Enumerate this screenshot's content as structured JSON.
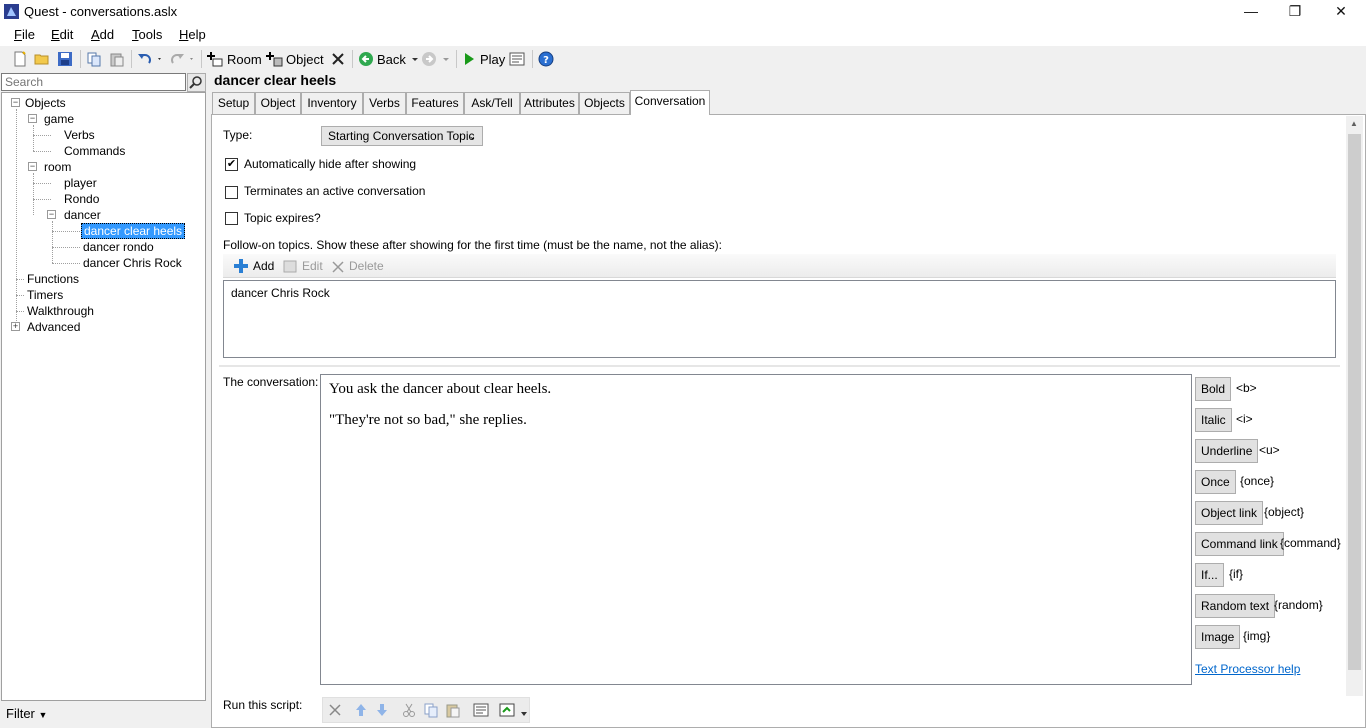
{
  "window": {
    "title": "Quest - conversations.aslx",
    "minimize": "—",
    "maximize": "❐",
    "close": "✕"
  },
  "menu": [
    "File",
    "Edit",
    "Add",
    "Tools",
    "Help"
  ],
  "toolbar": {
    "room_label": "Room",
    "object_label": "Object",
    "back_label": "Back",
    "play_label": "Play"
  },
  "left_panel": {
    "search_placeholder": "Search",
    "filter_label": "Filter",
    "tree": {
      "objects": "Objects",
      "game": "game",
      "verbs": "Verbs",
      "commands": "Commands",
      "room": "room",
      "player": "player",
      "rondo": "Rondo",
      "dancer": "dancer",
      "dancer_clear_heels": "dancer clear heels",
      "dancer_rondo": "dancer rondo",
      "dancer_chris_rock": "dancer Chris Rock",
      "functions": "Functions",
      "timers": "Timers",
      "walkthrough": "Walkthrough",
      "advanced": "Advanced"
    }
  },
  "editor": {
    "object_title": "dancer clear heels",
    "tabs": [
      "Setup",
      "Object",
      "Inventory",
      "Verbs",
      "Features",
      "Ask/Tell",
      "Attributes",
      "Objects",
      "Conversation"
    ],
    "active_tab": "Conversation",
    "type_label": "Type:",
    "type_value": "Starting Conversation Topic",
    "auto_hide_label": "Automatically hide after showing",
    "auto_hide_checked": true,
    "terminates_label": "Terminates an active conversation",
    "terminates_checked": false,
    "expires_label": "Topic expires?",
    "expires_checked": false,
    "followon_label": "Follow-on topics. Show these after showing for the first time (must be the name, not the alias):",
    "followon_add": "Add",
    "followon_edit": "Edit",
    "followon_delete": "Delete",
    "followon_items": [
      "dancer Chris Rock"
    ],
    "conversation_label": "The conversation:",
    "conversation_text": [
      "You ask the dancer about clear heels.",
      "\"They're not so bad,\" she replies."
    ],
    "format_buttons": [
      {
        "label": "Bold",
        "tag": "<b>"
      },
      {
        "label": "Italic",
        "tag": "<i>"
      },
      {
        "label": "Underline",
        "tag": "<u>"
      },
      {
        "label": "Once",
        "tag": "{once}"
      },
      {
        "label": "Object link",
        "tag": "{object}"
      },
      {
        "label": "Command link",
        "tag": "{command}"
      },
      {
        "label": "If...",
        "tag": "{if}"
      },
      {
        "label": "Random text",
        "tag": "{random}"
      },
      {
        "label": "Image",
        "tag": "{img}"
      }
    ],
    "help_link": "Text Processor help",
    "run_script_label": "Run this script:"
  },
  "colors": {
    "selection": "#3399ff",
    "link": "#0066cc",
    "play_green": "#1a9a1a",
    "add_blue": "#2a7fd4"
  }
}
